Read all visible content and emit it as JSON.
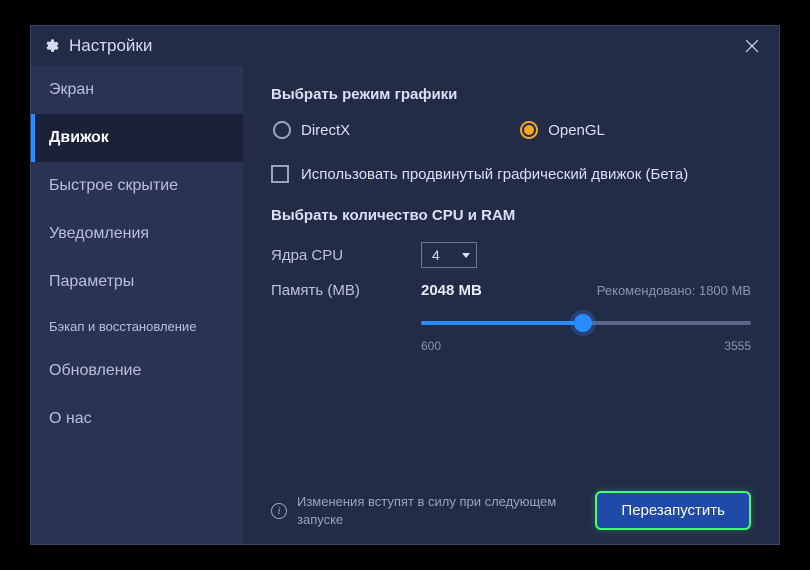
{
  "window": {
    "title": "Настройки"
  },
  "sidebar": {
    "items": [
      {
        "label": "Экран"
      },
      {
        "label": "Движок"
      },
      {
        "label": "Быстрое скрытие"
      },
      {
        "label": "Уведомления"
      },
      {
        "label": "Параметры"
      },
      {
        "label": "Бэкап и восстановление"
      },
      {
        "label": "Обновление"
      },
      {
        "label": "О нас"
      }
    ],
    "active_index": 1
  },
  "graphics": {
    "title": "Выбрать режим графики",
    "options": {
      "directx": "DirectX",
      "opengl": "OpenGL"
    },
    "selected": "opengl",
    "advanced_checkbox_label": "Использовать продвинутый графический движок (Бета)",
    "advanced_checked": false
  },
  "cpuram": {
    "title": "Выбрать количество CPU и RAM",
    "cpu_label": "Ядра CPU",
    "cpu_value": "4",
    "mem_label": "Память (MB)",
    "mem_value": "2048 MB",
    "recommended": "Рекомендовано: 1800 MB",
    "slider_min": "600",
    "slider_max": "3555"
  },
  "footer": {
    "info": "Изменения вступят в силу при следующем запуске",
    "restart": "Перезапустить"
  }
}
